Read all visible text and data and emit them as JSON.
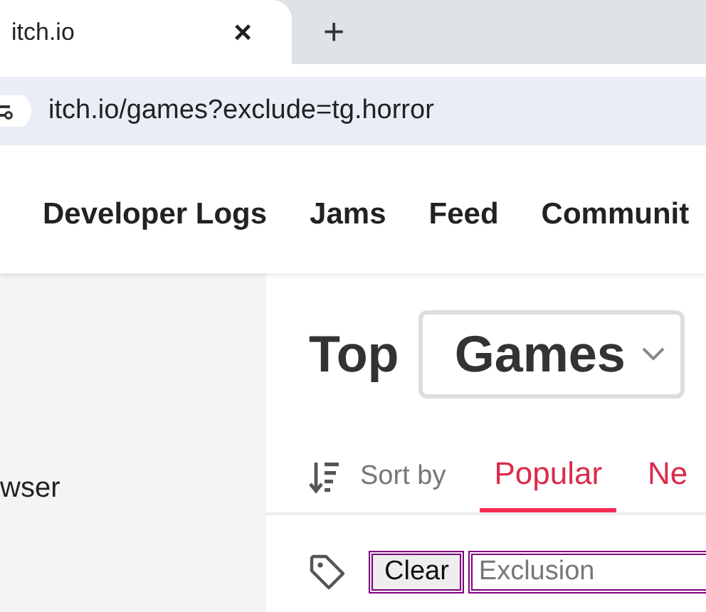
{
  "browser": {
    "tab": {
      "title": "itch.io",
      "close": "×"
    },
    "new_tab": "+",
    "address": "itch.io/games?exclude=tg.horror"
  },
  "nav": [
    {
      "label": "Developer Logs"
    },
    {
      "label": "Jams"
    },
    {
      "label": "Feed"
    },
    {
      "label": "Communit"
    }
  ],
  "sidebar": {
    "text": "wser"
  },
  "heading": {
    "prefix": "Top",
    "dropdown": "Games"
  },
  "sort": {
    "label": "Sort by",
    "options": [
      {
        "label": "Popular",
        "selected": true
      },
      {
        "label": "Ne",
        "selected": false
      }
    ]
  },
  "tags": {
    "button": "Clear",
    "placeholder": "Exclusion"
  }
}
